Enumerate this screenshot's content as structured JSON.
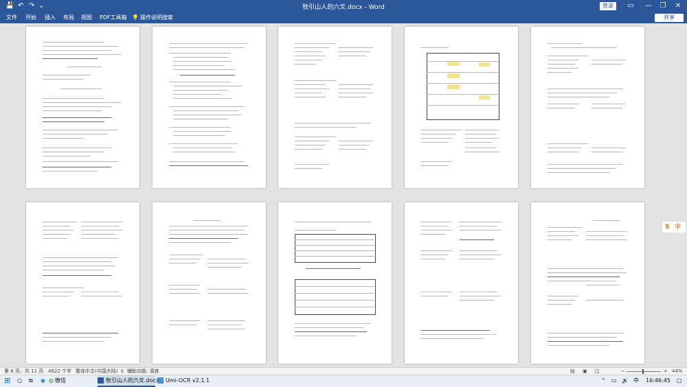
{
  "window": {
    "title": "牧引山人的六爻.docx - Word",
    "login_label": "登录",
    "controls": {
      "restore_ribbon": "▭",
      "minimize": "—",
      "maximize": "❐",
      "close": "✕"
    }
  },
  "quick_access": {
    "save": "💾",
    "undo": "↶",
    "redo": "↷",
    "customize": "⌄"
  },
  "ribbon": {
    "tabs": [
      "文件",
      "开始",
      "插入",
      "布局",
      "视图",
      "PDF工具箱"
    ],
    "tell_me": "操作说明搜索",
    "share_label": "共享"
  },
  "ime_widget": {
    "logo": "S",
    "mode": "中"
  },
  "status": {
    "page": "第 8 页，共 11 页",
    "words": "4622 个字",
    "language": "繁体中文(中国大陆)",
    "accessibility": "辅助功能: 调查",
    "zoom_minus": "−",
    "zoom_plus": "+",
    "zoom": "44%"
  },
  "taskbar": {
    "items": [
      "微信",
      "牧引山人的六爻.docx...",
      "Umi-OCR v2.1.1"
    ],
    "time": "16:46:45"
  },
  "colors": {
    "accent": "#2b579a",
    "highlight": "#f4e48d",
    "ime": "#ff6600"
  }
}
